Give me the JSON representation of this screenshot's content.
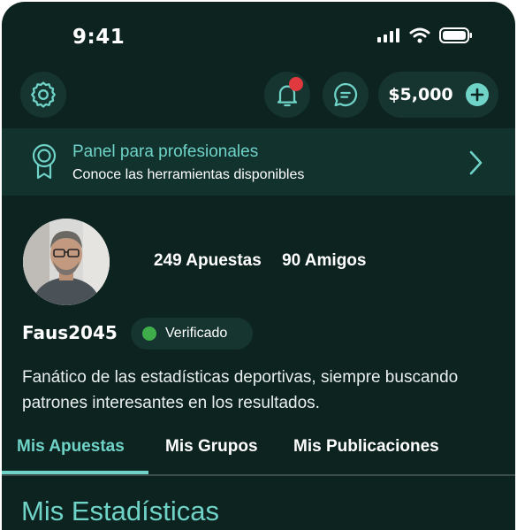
{
  "status_bar": {
    "time": "9:41"
  },
  "header": {
    "balance": "$5,000"
  },
  "pro_banner": {
    "title": "Panel para profesionales",
    "subtitle": "Conoce las herramientas disponibles"
  },
  "profile": {
    "bets_stat": "249 Apuestas",
    "friends_stat": "90 Amigos",
    "username": "Faus2045",
    "verified_label": "Verificado",
    "bio": "Fanático de las estadísticas deportivas, siempre buscando patrones interesantes en los resultados."
  },
  "tabs": [
    {
      "label": "Mis Apuestas",
      "active": true
    },
    {
      "label": "Mis Grupos",
      "active": false
    },
    {
      "label": "Mis Publicaciones",
      "active": false
    }
  ],
  "section": {
    "title": "Mis Estadísticas"
  },
  "colors": {
    "background": "#0d2320",
    "accent": "#6fd3c8",
    "notification": "#e0393e",
    "verified": "#3fae4a"
  },
  "icons": [
    "gear-icon",
    "bell-icon",
    "chat-icon",
    "plus-icon",
    "award-icon",
    "chevron-right-icon",
    "signal-icon",
    "wifi-icon",
    "battery-icon"
  ]
}
